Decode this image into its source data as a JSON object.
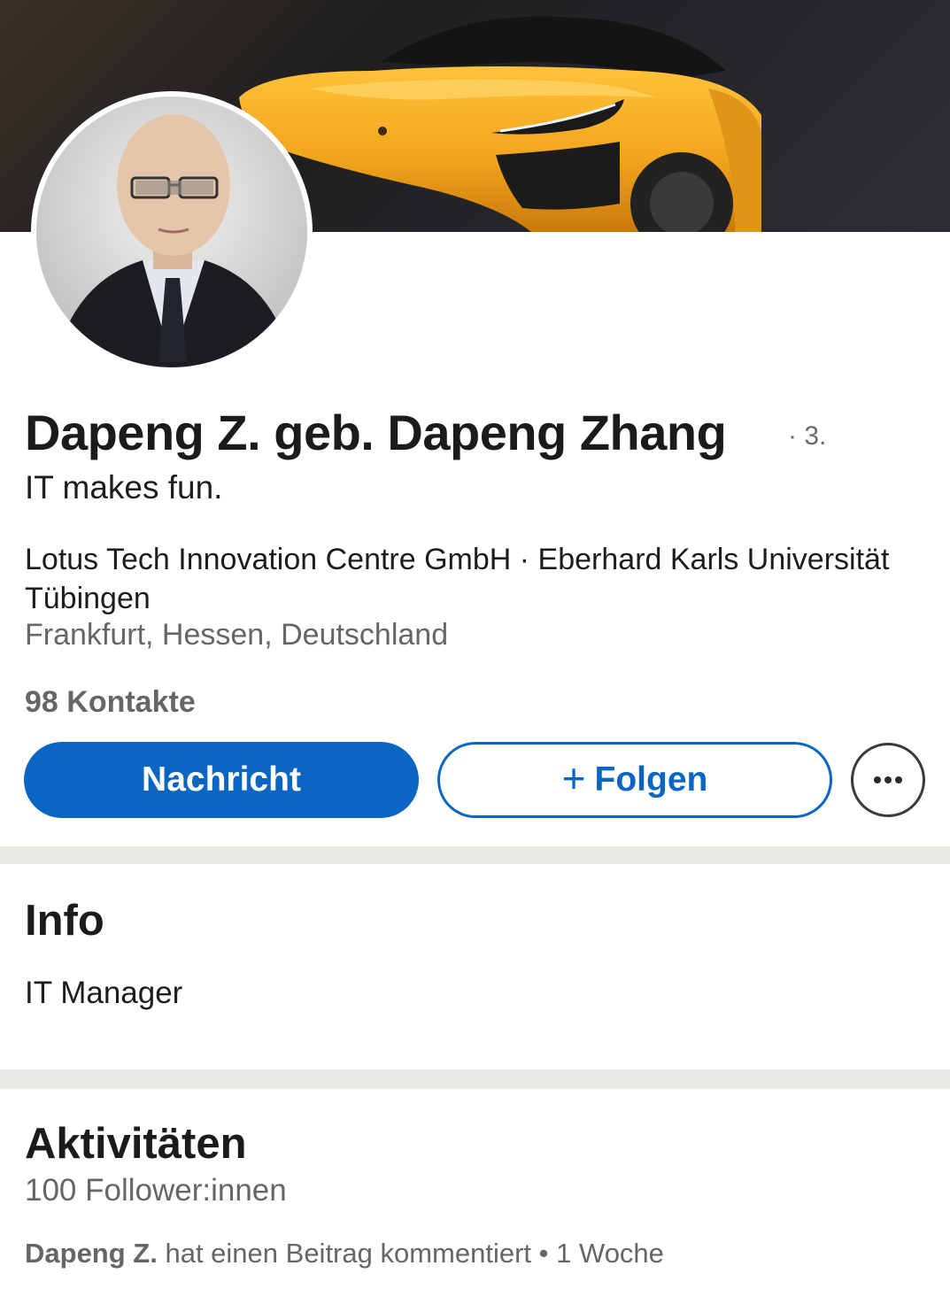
{
  "profile": {
    "name": "Dapeng Z. geb. Dapeng Zhang",
    "degree": "· 3.",
    "headline": "IT makes fun.",
    "organizations": "Lotus Tech Innovation Centre GmbH · Eberhard Karls Universität Tübingen",
    "location": "Frankfurt, Hessen, Deutschland",
    "contacts": "98 Kontakte"
  },
  "actions": {
    "message_label": "Nachricht",
    "follow_label": "Folgen",
    "follow_icon": "plus-icon",
    "more_icon": "more-dots-icon"
  },
  "info": {
    "title": "Info",
    "text": "IT Manager"
  },
  "activity": {
    "title": "Aktivitäten",
    "followers": "100 Follower:innen",
    "actor": "Dapeng Z.",
    "action": "hat einen Beitrag kommentiert",
    "separator": "•",
    "time": "1 Woche"
  },
  "colors": {
    "primary": "#0a66c2",
    "divider": "#ebe9e4",
    "cover_accent": "#f2a51c"
  }
}
